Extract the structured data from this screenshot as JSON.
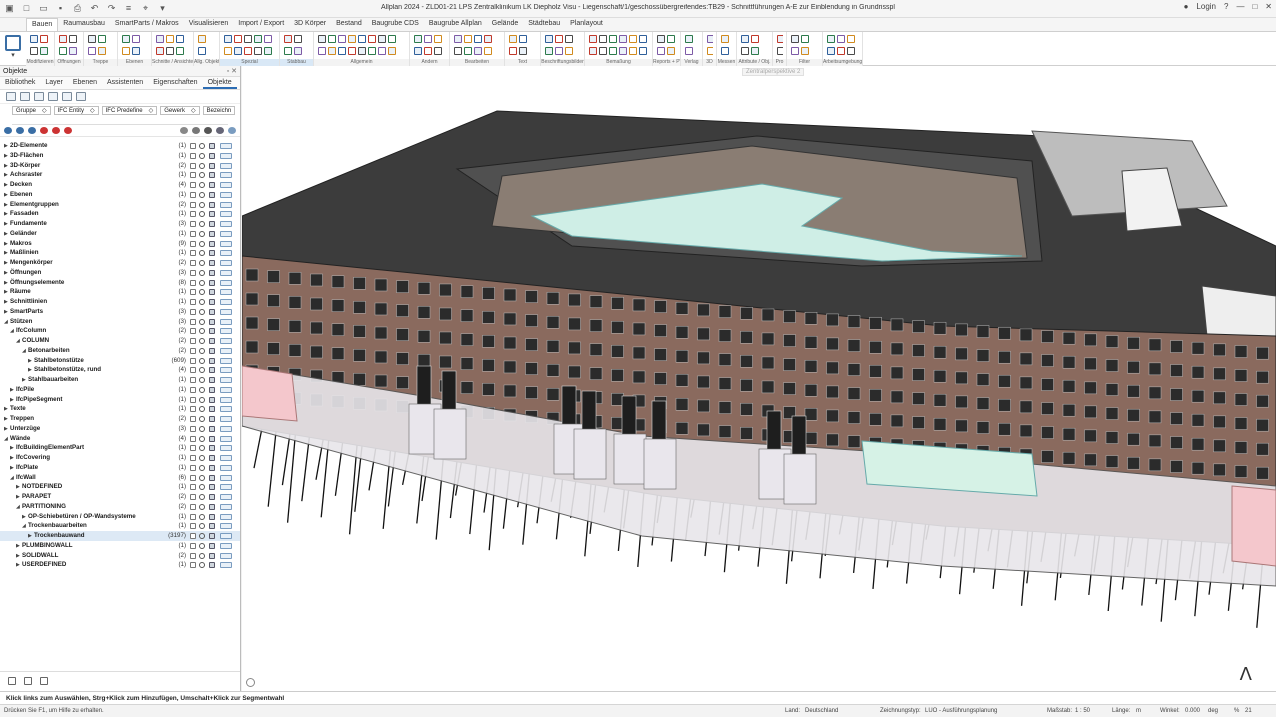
{
  "window": {
    "title": "Allplan 2024 - ZLD01-21 LPS Zentralklinikum LK Diepholz Visu - Liegenschaft/1/geschossübergreifendes:TB29 - Schnittführungen A-E zur Einblendung in Grundrisspl",
    "login": "Login",
    "colors": {
      "accent": "#2b6cb3",
      "window_bg": "#f0f0f0"
    }
  },
  "ribbon": {
    "tabs": [
      "Bauen",
      "Raumausbau",
      "SmartParts / Makros",
      "Visualisieren",
      "Import / Export",
      "3D Körper",
      "Bestand",
      "Baugrube CDS",
      "Baugrube Allplan",
      "Gelände",
      "Städtebau",
      "Planlayout"
    ],
    "active_tab": "Bauen",
    "groups": [
      "Modifizieren",
      "Öffnungen",
      "Treppe",
      "Ebenen",
      "Schnitte / Ansichten",
      "Allg. Objekte",
      "Spezial",
      "Stabbau",
      "Allgemein",
      "Ändern",
      "Bearbeiten",
      "Text",
      "Beschriftungsbilder",
      "Bemaßung",
      "Reports + PV",
      "Verlag",
      "3D",
      "Messen",
      "Attribute / Obj.",
      "Pro",
      "Filter",
      "Arbeitsumgebung"
    ]
  },
  "panel": {
    "title": "Objekte",
    "tabs": [
      "Bibliothek",
      "Layer",
      "Ebenen",
      "Assistenten",
      "Eigenschaften",
      "Objekte"
    ],
    "active_tab": "Objekte",
    "filters": [
      "Gruppe",
      "IFC Entity",
      "IFC Predefine",
      "Gewerk",
      "Bezeichn"
    ],
    "tree": [
      {
        "name": "2D-Elemente",
        "count": "(1)",
        "level": 0
      },
      {
        "name": "3D-Flächen",
        "count": "(1)",
        "level": 0
      },
      {
        "name": "3D-Körper",
        "count": "(2)",
        "level": 0
      },
      {
        "name": "Achsraster",
        "count": "(1)",
        "level": 0
      },
      {
        "name": "Decken",
        "count": "(4)",
        "level": 0
      },
      {
        "name": "Ebenen",
        "count": "(1)",
        "level": 0
      },
      {
        "name": "Elementgruppen",
        "count": "(2)",
        "level": 0
      },
      {
        "name": "Fassaden",
        "count": "(1)",
        "level": 0
      },
      {
        "name": "Fundamente",
        "count": "(3)",
        "level": 0
      },
      {
        "name": "Geländer",
        "count": "(1)",
        "level": 0
      },
      {
        "name": "Makros",
        "count": "(9)",
        "level": 0
      },
      {
        "name": "Maßlinien",
        "count": "(1)",
        "level": 0
      },
      {
        "name": "Mengenkörper",
        "count": "(2)",
        "level": 0
      },
      {
        "name": "Öffnungen",
        "count": "(3)",
        "level": 0
      },
      {
        "name": "Öffnungselemente",
        "count": "(8)",
        "level": 0
      },
      {
        "name": "Räume",
        "count": "(1)",
        "level": 0
      },
      {
        "name": "Schnittlinien",
        "count": "(1)",
        "level": 0
      },
      {
        "name": "SmartParts",
        "count": "(3)",
        "level": 0
      },
      {
        "name": "Stützen",
        "count": "(3)",
        "level": 0,
        "open": true
      },
      {
        "name": "IfcColumn",
        "count": "(2)",
        "level": 1,
        "open": true
      },
      {
        "name": "COLUMN",
        "count": "(2)",
        "level": 2,
        "open": true
      },
      {
        "name": "Betonarbeiten",
        "count": "(2)",
        "level": 3,
        "open": true
      },
      {
        "name": "Stahlbetonstütze",
        "count": "(609)",
        "level": 4
      },
      {
        "name": "Stahlbetonstütze, rund",
        "count": "(4)",
        "level": 4
      },
      {
        "name": "Stahlbauarbeiten",
        "count": "(1)",
        "level": 3
      },
      {
        "name": "IfcPile",
        "count": "(1)",
        "level": 1
      },
      {
        "name": "IfcPipeSegment",
        "count": "(1)",
        "level": 1
      },
      {
        "name": "Texte",
        "count": "(1)",
        "level": 0
      },
      {
        "name": "Treppen",
        "count": "(2)",
        "level": 0
      },
      {
        "name": "Unterzüge",
        "count": "(3)",
        "level": 0
      },
      {
        "name": "Wände",
        "count": "(4)",
        "level": 0,
        "open": true
      },
      {
        "name": "IfcBuildingElementPart",
        "count": "(1)",
        "level": 1
      },
      {
        "name": "IfcCovering",
        "count": "(1)",
        "level": 1
      },
      {
        "name": "IfcPlate",
        "count": "(1)",
        "level": 1
      },
      {
        "name": "IfcWall",
        "count": "(6)",
        "level": 1,
        "open": true
      },
      {
        "name": "NOTDEFINED",
        "count": "(1)",
        "level": 2
      },
      {
        "name": "PARAPET",
        "count": "(2)",
        "level": 2
      },
      {
        "name": "PARTITIONING",
        "count": "(2)",
        "level": 2,
        "open": true
      },
      {
        "name": "OP-Schiebetüren / OP-Wandsysteme",
        "count": "(1)",
        "level": 3
      },
      {
        "name": "Trockenbauarbeiten",
        "count": "(1)",
        "level": 3,
        "open": true
      },
      {
        "name": "Trockenbauwand",
        "count": "(3197)",
        "level": 4,
        "selected": true
      },
      {
        "name": "PLUMBINGWALL",
        "count": "(1)",
        "level": 2
      },
      {
        "name": "SOLIDWALL",
        "count": "(2)",
        "level": 2
      },
      {
        "name": "USERDEFINED",
        "count": "(1)",
        "level": 2
      }
    ]
  },
  "viewport": {
    "label": "Zentralperspektive 2"
  },
  "hint": "Klick links zum Auswählen, Strg+Klick zum Hinzufügen, Umschalt+Klick zur Segmentwahl",
  "status": {
    "help": "Drücken Sie F1, um Hilfe zu erhalten.",
    "land": "Land:",
    "land_value": "Deutschland",
    "zeichnungstyp": "Zeichnungstyp:",
    "zeichnungstyp_value": "LUO - Ausführungsplanung",
    "massstab": "Maßstab:",
    "massstab_value": "1 : 50",
    "laenge": "Länge:",
    "laenge_value": "m",
    "winkel": "Winkel:",
    "winkel_value": "0.000",
    "deg": "deg",
    "percent": "%",
    "percent_value": "21"
  }
}
